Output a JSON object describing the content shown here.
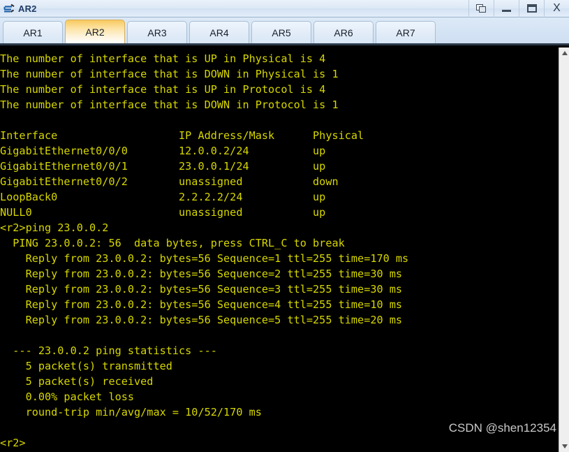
{
  "window": {
    "title": "AR2",
    "icon": "router-icon",
    "controls": [
      {
        "name": "restore-button",
        "label": "",
        "icon": "restore-icon"
      },
      {
        "name": "minimize-button",
        "label": "",
        "icon": "minimize-icon"
      },
      {
        "name": "maximize-button",
        "label": "",
        "icon": "maximize-icon"
      },
      {
        "name": "close-button",
        "label": "X",
        "icon": "close-icon"
      }
    ]
  },
  "tabs": {
    "active_index": 1,
    "items": [
      {
        "label": "AR1"
      },
      {
        "label": "AR2"
      },
      {
        "label": "AR3"
      },
      {
        "label": "AR4"
      },
      {
        "label": "AR5"
      },
      {
        "label": "AR6"
      },
      {
        "label": "AR7"
      }
    ]
  },
  "terminal": {
    "foreground_color": "#d7d700",
    "background_color": "#000000",
    "summary": {
      "up_physical": 4,
      "down_physical": 1,
      "up_protocol": 4,
      "down_protocol": 1
    },
    "interface_table": {
      "headers": [
        "Interface",
        "IP Address/Mask",
        "Physical"
      ],
      "rows": [
        {
          "interface": "GigabitEthernet0/0/0",
          "ip": "12.0.0.2/24",
          "physical": "up"
        },
        {
          "interface": "GigabitEthernet0/0/1",
          "ip": "23.0.0.1/24",
          "physical": "up"
        },
        {
          "interface": "GigabitEthernet0/0/2",
          "ip": "unassigned",
          "physical": "down"
        },
        {
          "interface": "LoopBack0",
          "ip": "2.2.2.2/24",
          "physical": "up"
        },
        {
          "interface": "NULL0",
          "ip": "unassigned",
          "physical": "up"
        }
      ]
    },
    "ping": {
      "prompt": "<r2>",
      "command": "ping 23.0.0.2",
      "target": "23.0.0.2",
      "data_bytes": 56,
      "replies": [
        {
          "sequence": 1,
          "bytes": 56,
          "ttl": 255,
          "time_ms": 170
        },
        {
          "sequence": 2,
          "bytes": 56,
          "ttl": 255,
          "time_ms": 30
        },
        {
          "sequence": 3,
          "bytes": 56,
          "ttl": 255,
          "time_ms": 30
        },
        {
          "sequence": 4,
          "bytes": 56,
          "ttl": 255,
          "time_ms": 10
        },
        {
          "sequence": 5,
          "bytes": 56,
          "ttl": 255,
          "time_ms": 20
        }
      ],
      "statistics": {
        "transmitted": 5,
        "received": 5,
        "packet_loss": "0.00%",
        "round_trip_min": 10,
        "round_trip_avg": 52,
        "round_trip_max": 170
      }
    },
    "lines": [
      "The number of interface that is UP in Physical is 4",
      "The number of interface that is DOWN in Physical is 1",
      "The number of interface that is UP in Protocol is 4",
      "The number of interface that is DOWN in Protocol is 1",
      "",
      "Interface                   IP Address/Mask      Physical",
      "GigabitEthernet0/0/0        12.0.0.2/24          up",
      "GigabitEthernet0/0/1        23.0.0.1/24          up",
      "GigabitEthernet0/0/2        unassigned           down",
      "LoopBack0                   2.2.2.2/24           up",
      "NULL0                       unassigned           up",
      "<r2>ping 23.0.0.2",
      "  PING 23.0.0.2: 56  data bytes, press CTRL_C to break",
      "    Reply from 23.0.0.2: bytes=56 Sequence=1 ttl=255 time=170 ms",
      "    Reply from 23.0.0.2: bytes=56 Sequence=2 ttl=255 time=30 ms",
      "    Reply from 23.0.0.2: bytes=56 Sequence=3 ttl=255 time=30 ms",
      "    Reply from 23.0.0.2: bytes=56 Sequence=4 ttl=255 time=10 ms",
      "    Reply from 23.0.0.2: bytes=56 Sequence=5 ttl=255 time=20 ms",
      "",
      "  --- 23.0.0.2 ping statistics ---",
      "    5 packet(s) transmitted",
      "    5 packet(s) received",
      "    0.00% packet loss",
      "    round-trip min/avg/max = 10/52/170 ms",
      "",
      "<r2>"
    ]
  },
  "watermark": {
    "text": "CSDN @shen12354"
  },
  "scrollbar": {
    "up_arrow": "scroll-up-arrow",
    "down_arrow": "scroll-down-arrow"
  }
}
